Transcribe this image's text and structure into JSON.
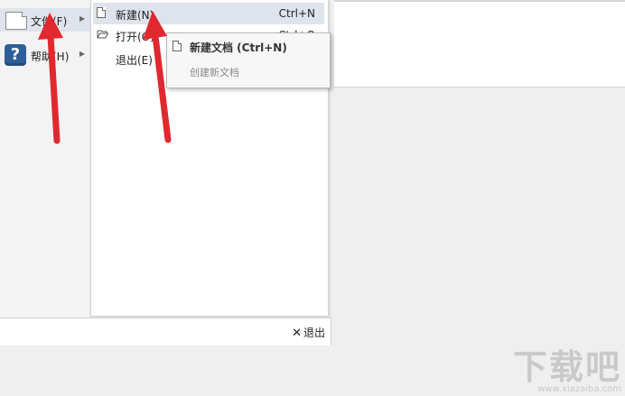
{
  "main_menu": {
    "items": [
      {
        "label": "文件(F)",
        "icon": "document-icon",
        "has_submenu": true,
        "selected": true
      },
      {
        "label": "帮助(H)",
        "icon": "help-icon",
        "has_submenu": true,
        "selected": false
      }
    ]
  },
  "file_submenu": {
    "items": [
      {
        "label": "新建(N)",
        "shortcut": "Ctrl+N",
        "icon": "document-icon"
      },
      {
        "label": "打开(O)",
        "shortcut": "Ctrl+O",
        "icon": "folder-open-icon"
      },
      {
        "label": "退出(E)",
        "shortcut": "",
        "icon": ""
      }
    ]
  },
  "tooltip": {
    "title": "新建文档 (Ctrl+N)",
    "description": "创建新文档"
  },
  "bottom_bar": {
    "exit_label": "退出"
  },
  "annotation": {
    "arrow_color": "#e0282e"
  },
  "watermark": {
    "text": "下载吧",
    "url": "www.xiazaiba.com"
  },
  "colors": {
    "selection": "#dfe3ec",
    "menu_bg": "#f3f3f3"
  }
}
